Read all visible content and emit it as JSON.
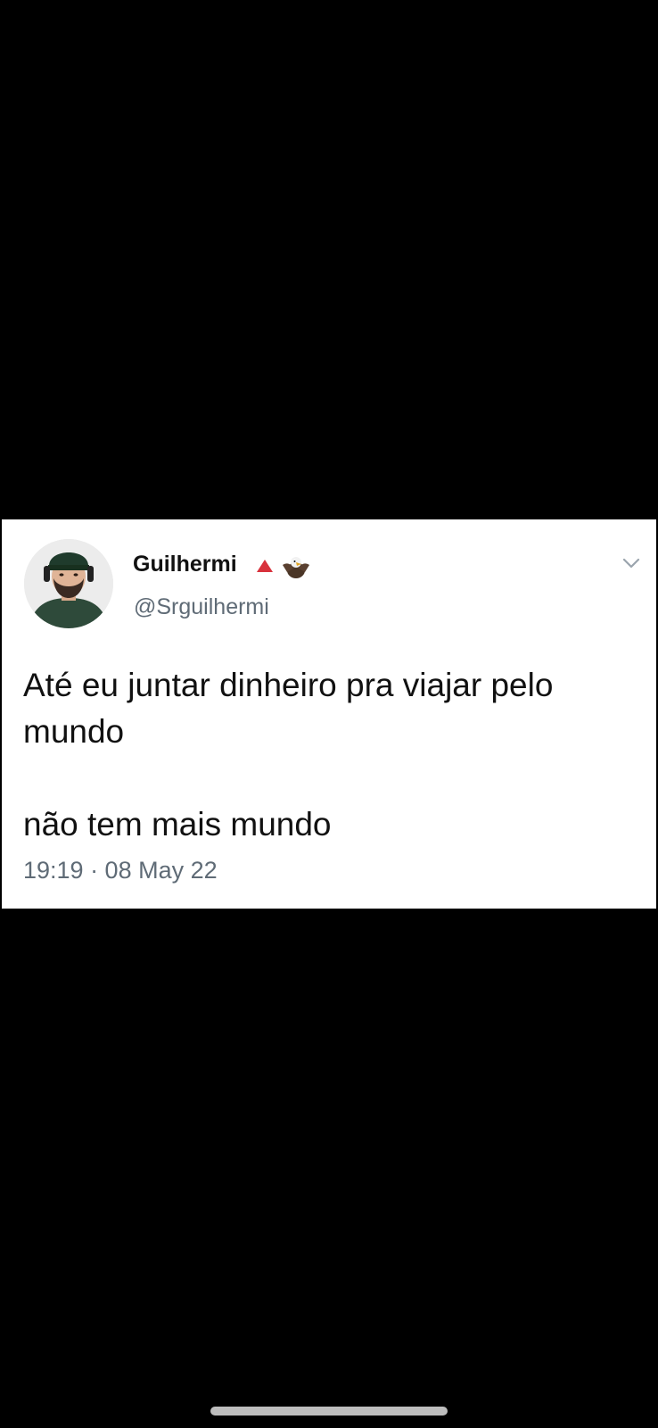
{
  "tweet": {
    "display_name": "Guilhermi",
    "handle": "@Srguilhermi",
    "text_line1": "Até eu juntar dinheiro pra viajar pelo mundo",
    "text_line2": "não tem mais mundo",
    "timestamp": "19:19 · 08 May 22",
    "menu_icon": "chevron-down-icon"
  },
  "colors": {
    "background": "#000000",
    "card": "#ffffff",
    "text": "#111111",
    "secondary_text": "#5f6b76",
    "badge_red": "#d8323c"
  }
}
